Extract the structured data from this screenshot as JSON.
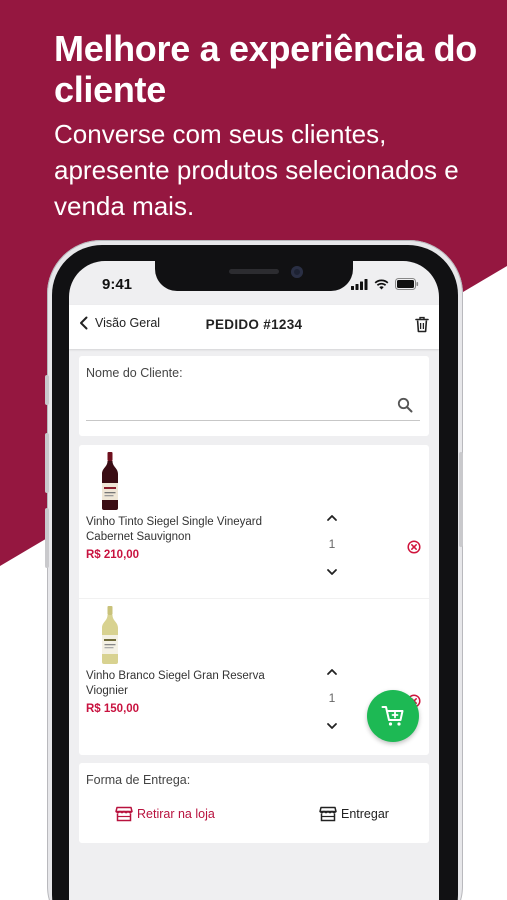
{
  "promo": {
    "headline": "Melhore a experiência do cliente",
    "subtitle": "Converse com seus clientes, apresente produtos selecionados e venda mais."
  },
  "colors": {
    "brand": "#951740",
    "price": "#c8123f",
    "fab": "#1db954",
    "screen_bg": "#efeff1"
  },
  "status_bar": {
    "time": "9:41",
    "icons": [
      "signal-icon",
      "wifi-icon",
      "battery-icon"
    ]
  },
  "navbar": {
    "back_label": "Visão Geral",
    "title": "PEDIDO #1234",
    "trash_icon": "trash-icon"
  },
  "client": {
    "label": "Nome do Cliente:",
    "value": "",
    "search_icon": "search-icon"
  },
  "order_items": [
    {
      "name": "Vinho Tinto Siegel Single Vineyard Cabernet Sauvignon",
      "price": "R$ 210,00",
      "quantity": "1",
      "bottle": "red-wine-bottle"
    },
    {
      "name": "Vinho Branco Siegel Gran Reserva Viognier",
      "price": "R$ 150,00",
      "quantity": "1",
      "bottle": "white-wine-bottle"
    }
  ],
  "delivery": {
    "label": "Forma de Entrega:",
    "options": [
      {
        "label": "Retirar na loja",
        "icon": "store-icon",
        "selected": true
      },
      {
        "label": "Entregar",
        "icon": "store-icon",
        "selected": false
      }
    ]
  },
  "fab": {
    "icon": "cart-add-icon"
  }
}
